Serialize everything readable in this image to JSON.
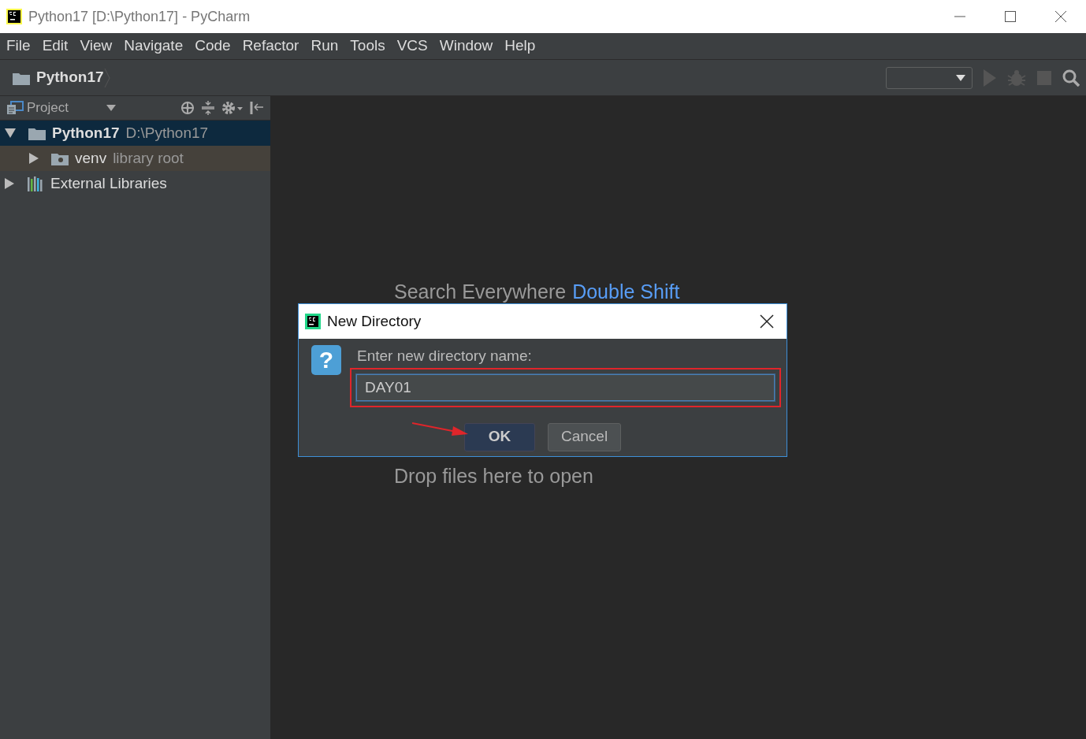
{
  "window": {
    "title": "Python17 [D:\\Python17] - PyCharm"
  },
  "menu": [
    "File",
    "Edit",
    "View",
    "Navigate",
    "Code",
    "Refactor",
    "Run",
    "Tools",
    "VCS",
    "Window",
    "Help"
  ],
  "navbar": {
    "breadcrumb": "Python17"
  },
  "project_panel": {
    "title": "Project",
    "tree": [
      {
        "name": "Python17",
        "detail": "D:\\Python17",
        "kind": "folder",
        "expanded": true,
        "selected": true,
        "children": [
          {
            "name": "venv",
            "detail": "library root",
            "kind": "library-folder",
            "expanded": false,
            "selected": false
          }
        ]
      },
      {
        "name": "External Libraries",
        "kind": "libraries",
        "expanded": false,
        "selected": false
      }
    ]
  },
  "editor": {
    "hints": [
      {
        "label": "Search Everywhere",
        "shortcut": "Double Shift"
      },
      {
        "label": "Drop files here to open"
      }
    ]
  },
  "dialog": {
    "title": "New Directory",
    "icon_glyph": "?",
    "prompt": "Enter new directory name:",
    "value": "DAY01",
    "buttons": [
      {
        "label": "OK",
        "default": true
      },
      {
        "label": "Cancel",
        "default": false
      }
    ]
  }
}
